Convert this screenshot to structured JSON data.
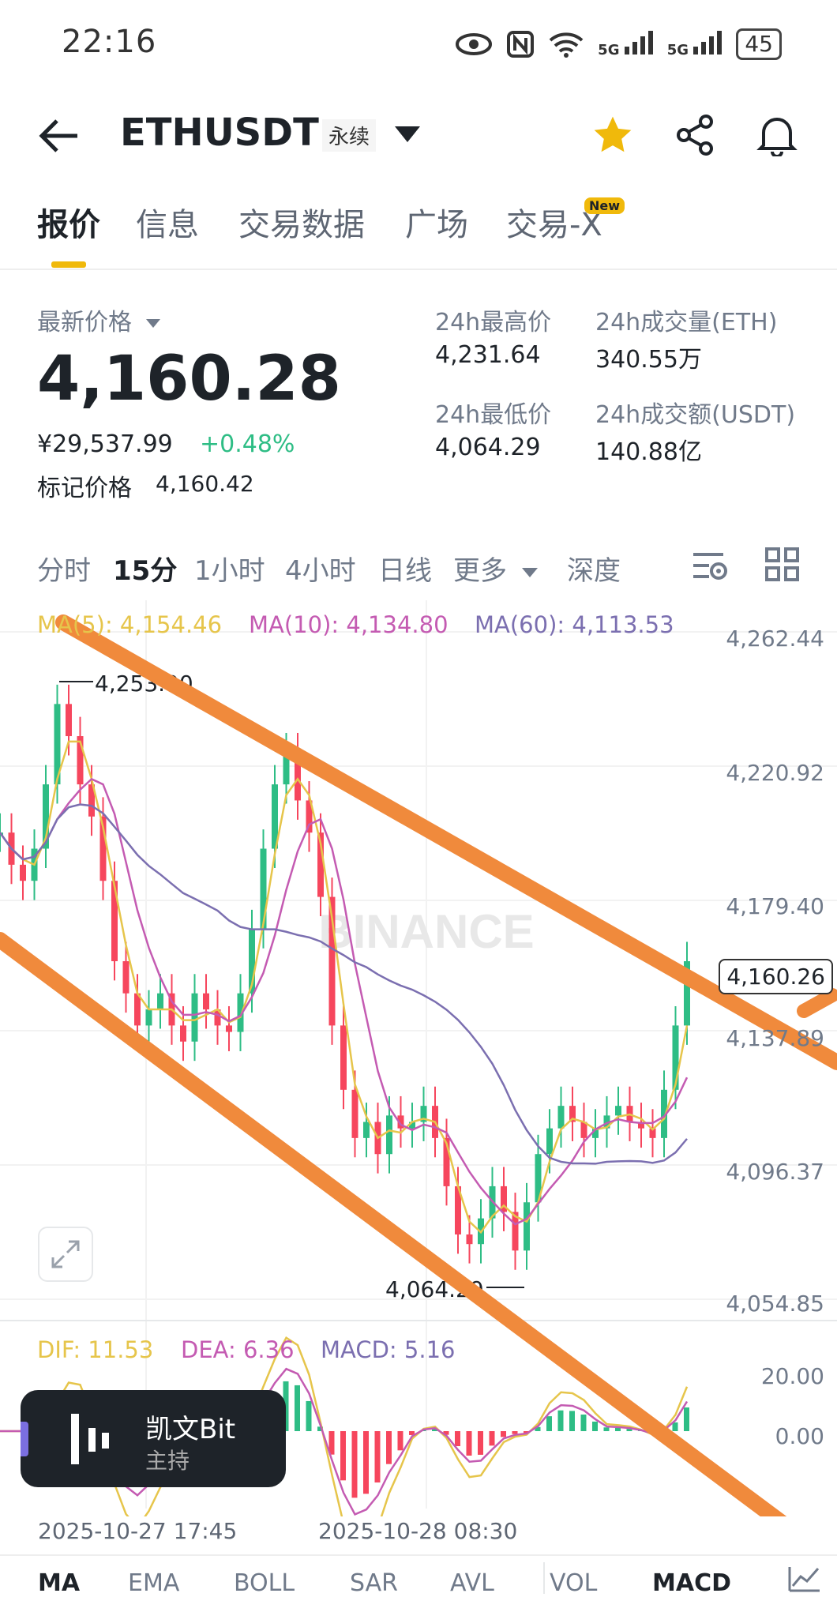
{
  "status_bar": {
    "time": "22:16",
    "network_1": "5G",
    "network_2": "5G",
    "battery": "45"
  },
  "header": {
    "symbol": "ETHUSDT",
    "contract_type": "永续"
  },
  "tabs": [
    {
      "label": "报价",
      "active": true
    },
    {
      "label": "信息"
    },
    {
      "label": "交易数据"
    },
    {
      "label": "广场"
    },
    {
      "label": "交易-X",
      "badge": "New"
    }
  ],
  "price": {
    "last_label": "最新价格",
    "last": "4,160.28",
    "cny": "¥29,537.99",
    "change": "+0.48%",
    "mark_label": "标记价格",
    "mark": "4,160.42"
  },
  "stats": {
    "high_label": "24h最高价",
    "high": "4,231.64",
    "vol_eth_label": "24h成交量(ETH)",
    "vol_eth": "340.55万",
    "low_label": "24h最低价",
    "low": "4,064.29",
    "vol_usdt_label": "24h成交额(USDT)",
    "vol_usdt": "140.88亿"
  },
  "intervals": [
    "分时",
    "15分",
    "1小时",
    "4小时",
    "日线",
    "更多",
    "深度"
  ],
  "active_interval": "15分",
  "chart": {
    "ma5": "MA(5): 4,154.46",
    "ma10": "MA(10): 4,134.80",
    "ma60": "MA(60): 4,113.53",
    "y_ticks": [
      "4,262.44",
      "4,220.92",
      "4,179.40",
      "4,137.89",
      "4,096.37",
      "4,054.85"
    ],
    "current_price_badge": "4,160.26",
    "high_marker": "4,253.00",
    "low_marker": "4,064.29",
    "watermark": "BINANCE"
  },
  "macd": {
    "dif": "DIF: 11.53",
    "dea": "DEA: 6.36",
    "macd": "MACD: 5.16",
    "y_ticks": [
      "20.00",
      "0.00"
    ]
  },
  "x_ticks": [
    "2025-10-27 17:45",
    "2025-10-28 08:30"
  ],
  "host": {
    "name": "凯文Bit",
    "role": "主持"
  },
  "indicator_tabs": [
    "MA",
    "EMA",
    "BOLL",
    "SAR",
    "AVL",
    "VOL",
    "MACD"
  ],
  "colors": {
    "up": "#2ebd85",
    "down": "#f6465d",
    "accent": "#f0b90b",
    "trendline": "#f08a3c"
  },
  "chart_data": {
    "type": "candlestick",
    "title": "",
    "interval": "15分",
    "y_range": [
      4054.85,
      4262.44
    ],
    "high": 4253.0,
    "low": 4064.29,
    "close": 4160.26,
    "overlays": [
      "MA(5)",
      "MA(10)",
      "MA(60)"
    ],
    "sub_indicator": "MACD"
  }
}
